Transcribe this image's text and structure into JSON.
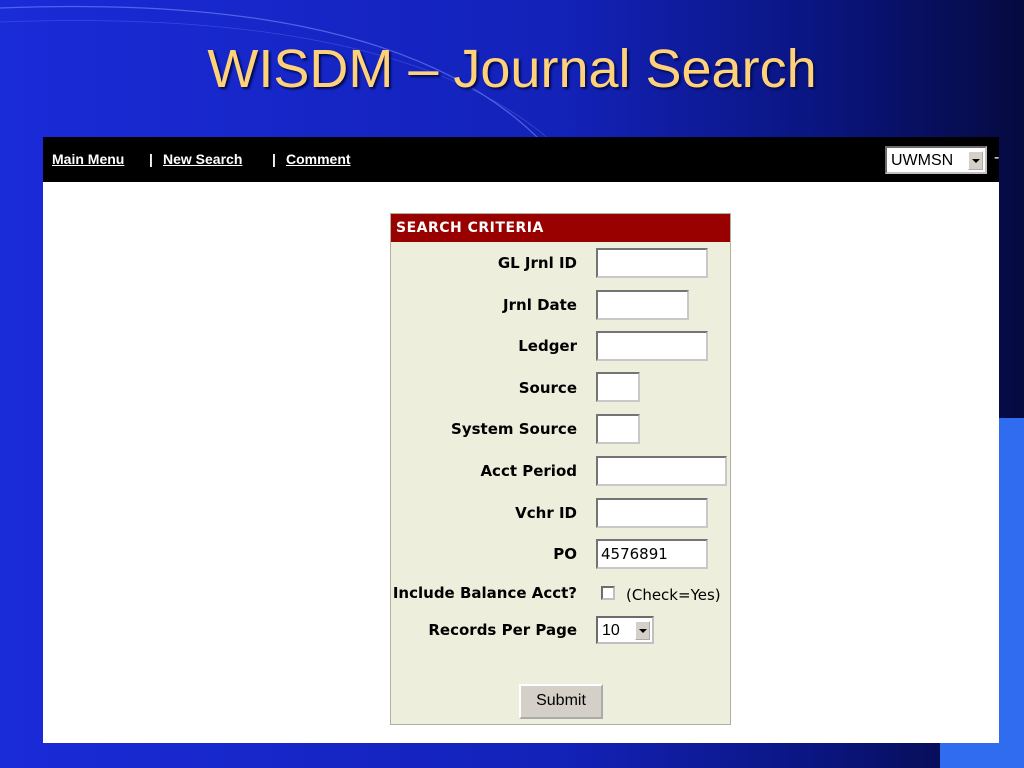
{
  "slide": {
    "title": "WISDM – Journal Search"
  },
  "nav": {
    "main_menu": "Main Menu",
    "separator": "|",
    "new_search": "New Search",
    "comment": "Comment",
    "institution_selected": "UWMSN",
    "trailing": "-"
  },
  "search_panel": {
    "header": "SEARCH CRITERIA",
    "fields": [
      {
        "label": "GL Jrnl ID",
        "value": ""
      },
      {
        "label": "Jrnl Date",
        "value": ""
      },
      {
        "label": "Ledger",
        "value": ""
      },
      {
        "label": "Source",
        "value": ""
      },
      {
        "label": "System Source",
        "value": ""
      },
      {
        "label": "Acct Period",
        "value": ""
      },
      {
        "label": "Vchr ID",
        "value": ""
      },
      {
        "label": "PO",
        "value": "4576891"
      }
    ],
    "balance_label": "Include Balance Acct?",
    "balance_hint": "(Check=Yes)",
    "balance_checked": false,
    "records_label": "Records Per Page",
    "records_value": "10",
    "submit_label": "Submit"
  },
  "colors": {
    "background": "#1a2bd8",
    "title": "#ffd27a",
    "header_bar": "#990000",
    "panel_bg": "#eeeedc",
    "accent_block": "#2f6cf0"
  }
}
